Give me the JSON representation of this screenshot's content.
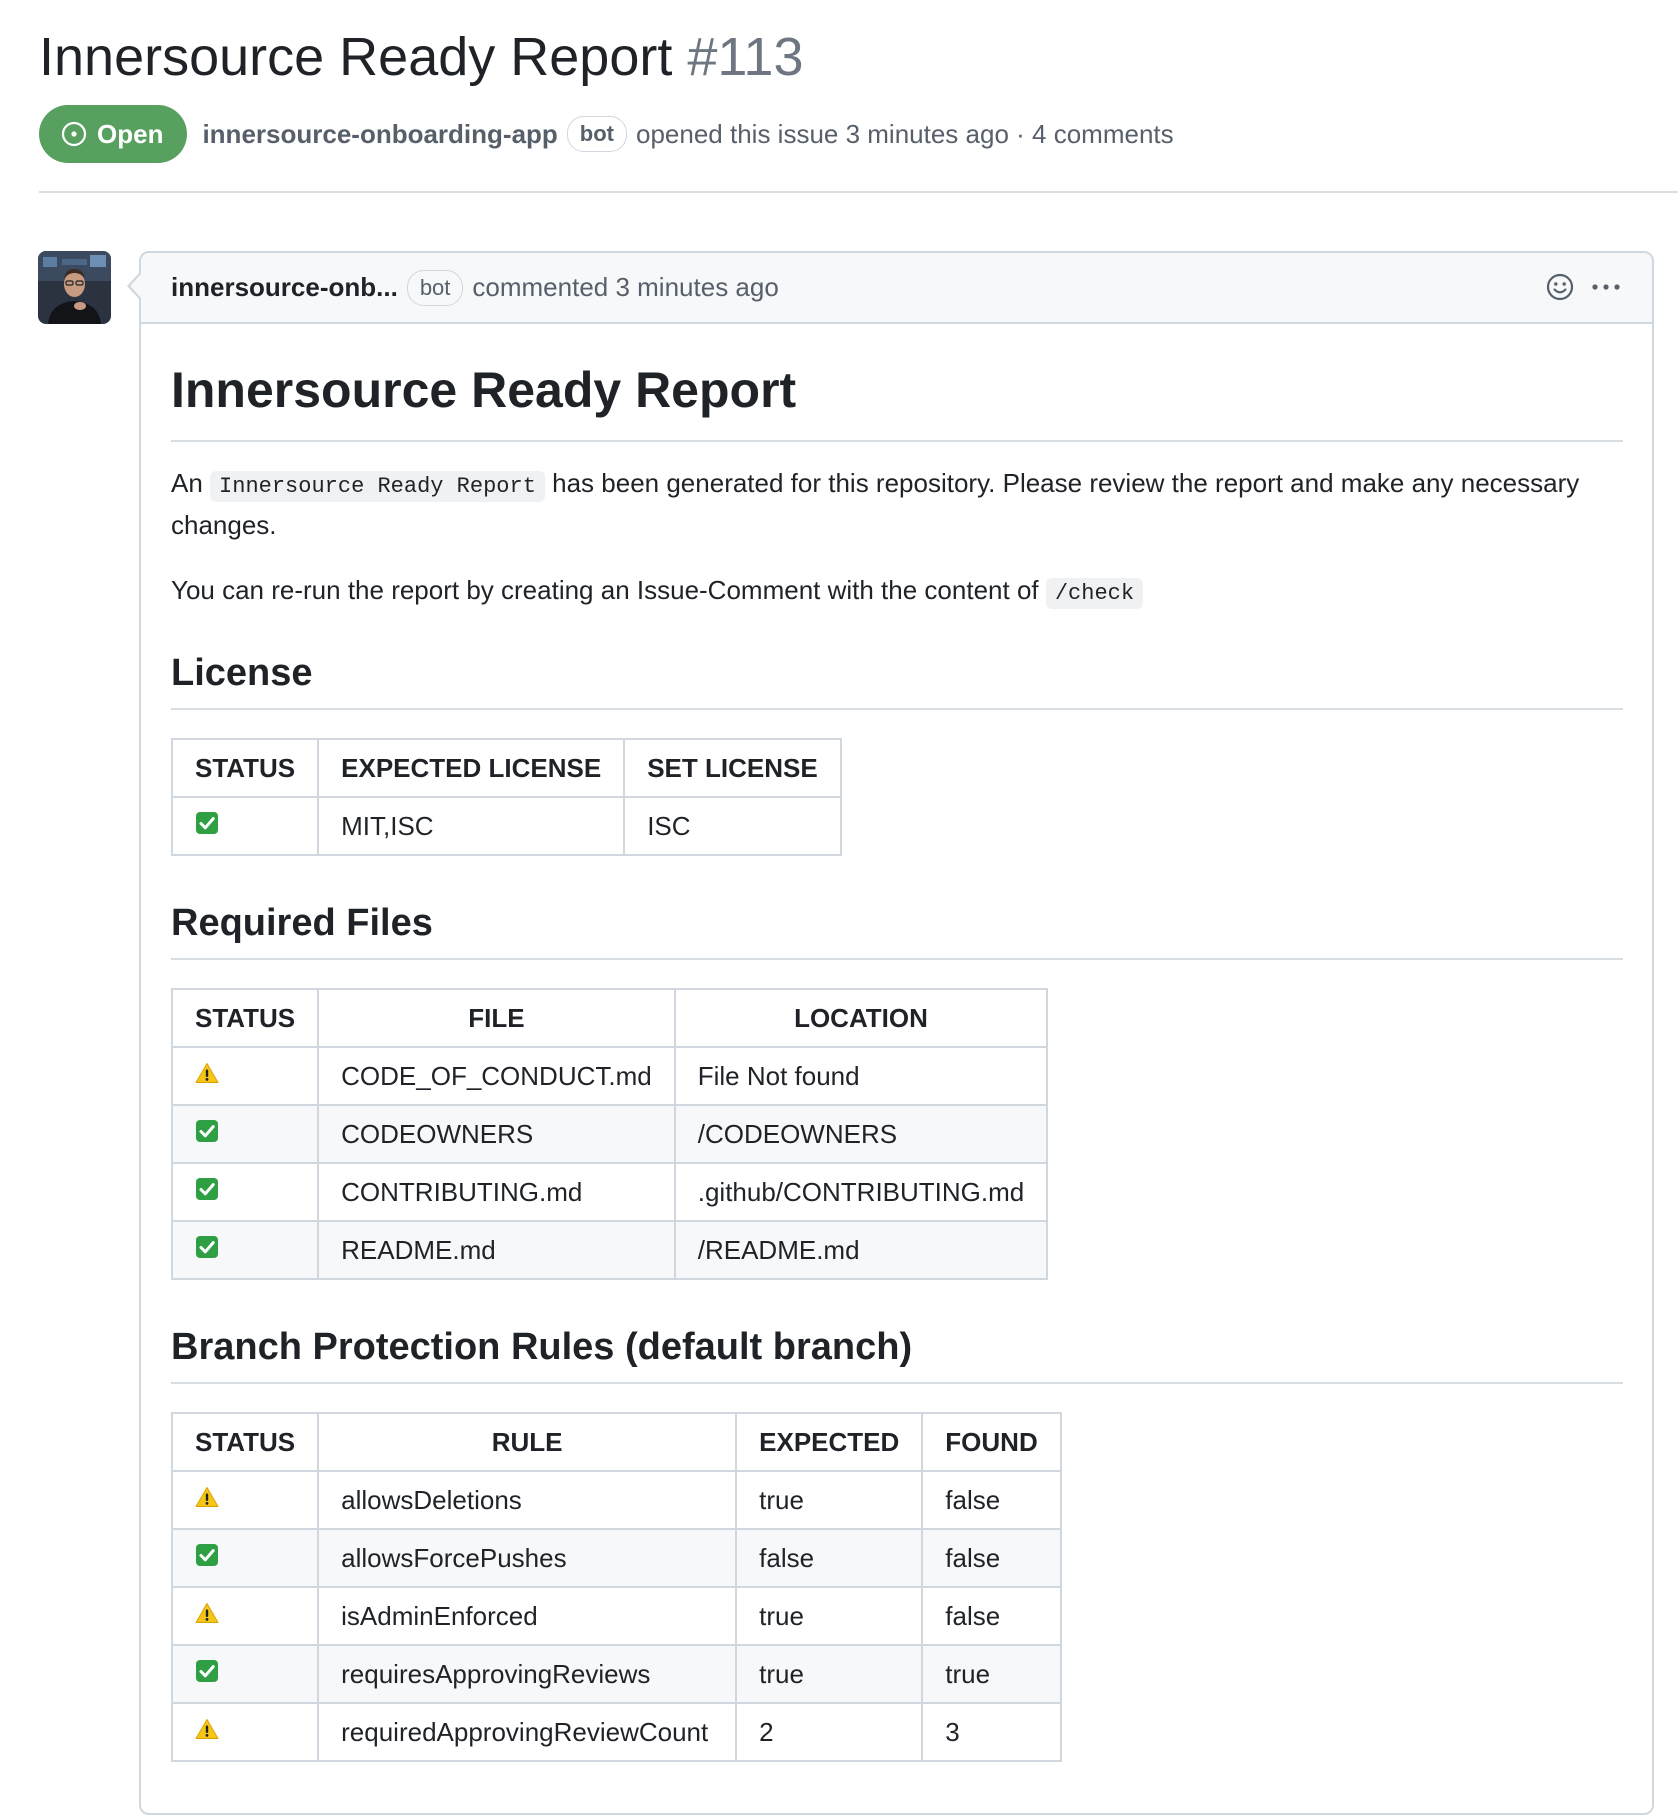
{
  "issue": {
    "title": "Innersource Ready Report",
    "number": "#113",
    "state": "Open",
    "author": "innersource-onboarding-app",
    "author_badge": "bot",
    "meta": "opened this issue 3 minutes ago · 4 comments"
  },
  "comment": {
    "author": "innersource-onb...",
    "author_badge": "bot",
    "action": "commented 3 minutes ago",
    "body": {
      "title": "Innersource Ready Report",
      "intro_prefix": "An",
      "intro_code": "Innersource Ready Report",
      "intro_suffix": "has been generated for this repository. Please review the report and make any necessary changes.",
      "rerun_text": "You can re-run the report by creating an Issue-Comment with the content of",
      "rerun_code": "/check",
      "license": {
        "heading": "License",
        "headers": [
          "STATUS",
          "EXPECTED LICENSE",
          "SET LICENSE"
        ],
        "rows": [
          {
            "status": "check",
            "expected": "MIT,ISC",
            "set": "ISC"
          }
        ]
      },
      "required_files": {
        "heading": "Required Files",
        "headers": [
          "STATUS",
          "FILE",
          "LOCATION"
        ],
        "rows": [
          {
            "status": "warning",
            "file": "CODE_OF_CONDUCT.md",
            "location": "File Not found"
          },
          {
            "status": "check",
            "file": "CODEOWNERS",
            "location": "/CODEOWNERS"
          },
          {
            "status": "check",
            "file": "CONTRIBUTING.md",
            "location": ".github/CONTRIBUTING.md"
          },
          {
            "status": "check",
            "file": "README.md",
            "location": "/README.md"
          }
        ]
      },
      "branch_protection": {
        "heading": "Branch Protection Rules (default branch)",
        "headers": [
          "STATUS",
          "RULE",
          "EXPECTED",
          "FOUND"
        ],
        "rows": [
          {
            "status": "warning",
            "rule": "allowsDeletions",
            "expected": "true",
            "found": "false"
          },
          {
            "status": "check",
            "rule": "allowsForcePushes",
            "expected": "false",
            "found": "false"
          },
          {
            "status": "warning",
            "rule": "isAdminEnforced",
            "expected": "true",
            "found": "false"
          },
          {
            "status": "check",
            "rule": "requiresApprovingReviews",
            "expected": "true",
            "found": "true"
          },
          {
            "status": "warning",
            "rule": "requiredApprovingReviewCount",
            "expected": "2",
            "found": "3"
          }
        ]
      }
    }
  },
  "colors": {
    "open_badge": "#57a05f",
    "check_green": "#2ea043",
    "warning_yellow": "#f5c518",
    "muted_text": "#57606a",
    "border": "#d0d7de"
  },
  "icons": {
    "state": "issue-opened-icon",
    "reaction": "smiley-icon",
    "menu": "kebab-horizontal-icon",
    "pass": "white-check-mark-icon",
    "warn": "warning-icon"
  }
}
